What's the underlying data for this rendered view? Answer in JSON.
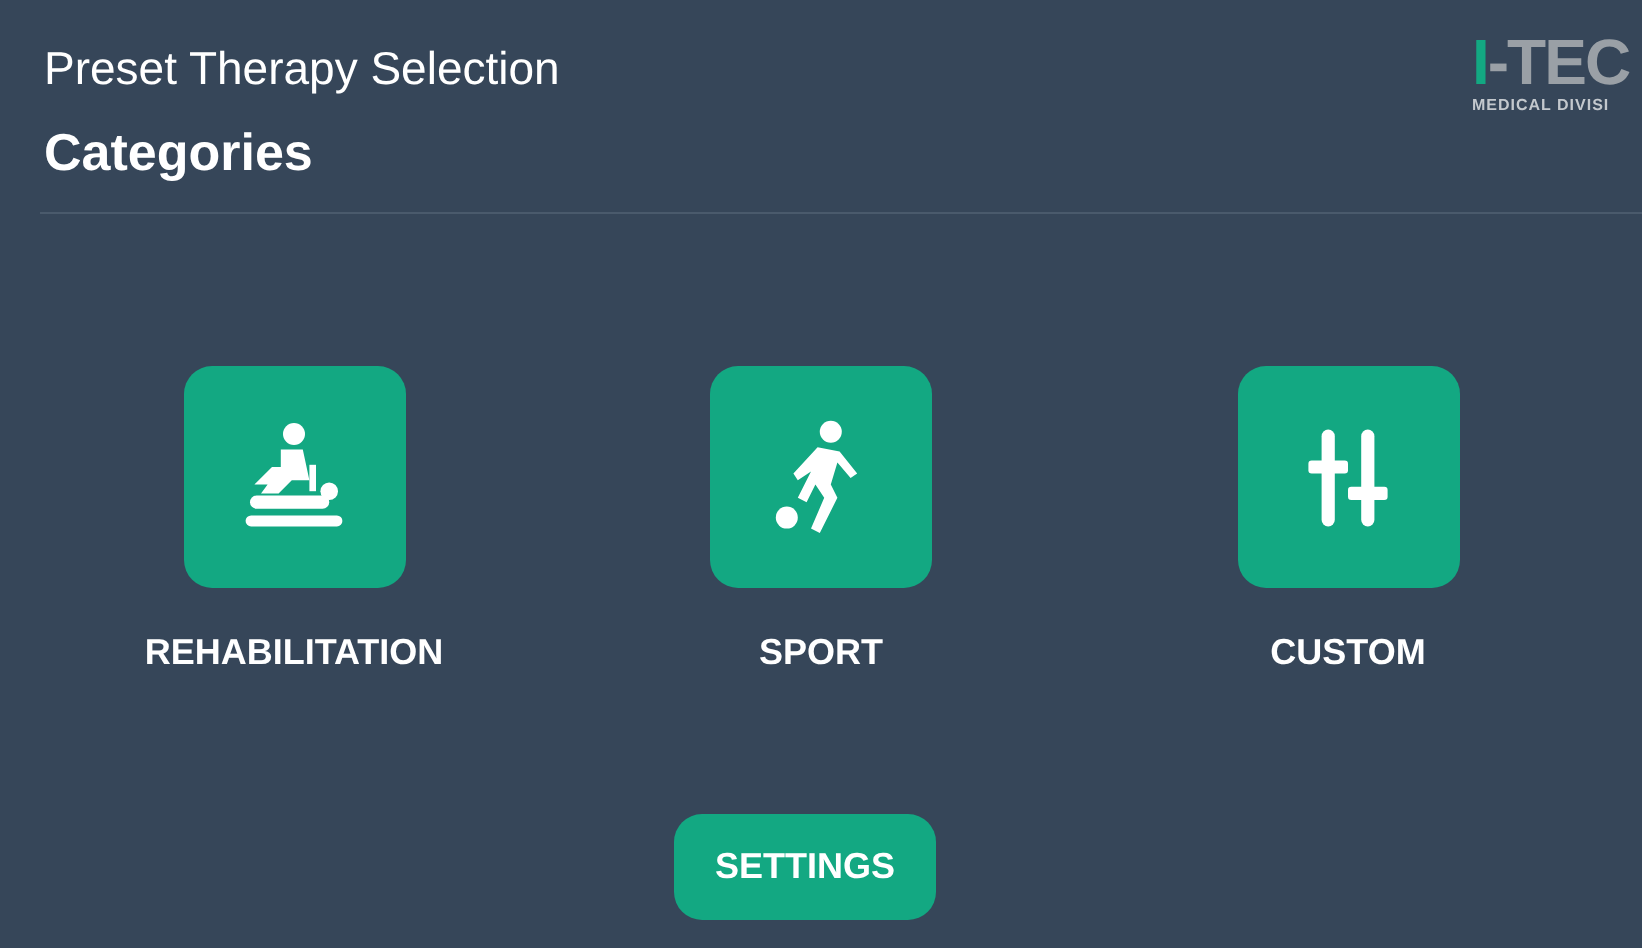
{
  "header": {
    "title": "Preset Therapy Selection",
    "subtitle": "Categories"
  },
  "logo": {
    "mark": "I",
    "word": "-TEC",
    "tagline": "MEDICAL DIVISI"
  },
  "categories": [
    {
      "kind": "rehabilitation",
      "label": "REHABILITATION"
    },
    {
      "kind": "sport",
      "label": "SPORT"
    },
    {
      "kind": "custom",
      "label": "CUSTOM"
    }
  ],
  "settings_button": {
    "label": "SETTINGS"
  }
}
